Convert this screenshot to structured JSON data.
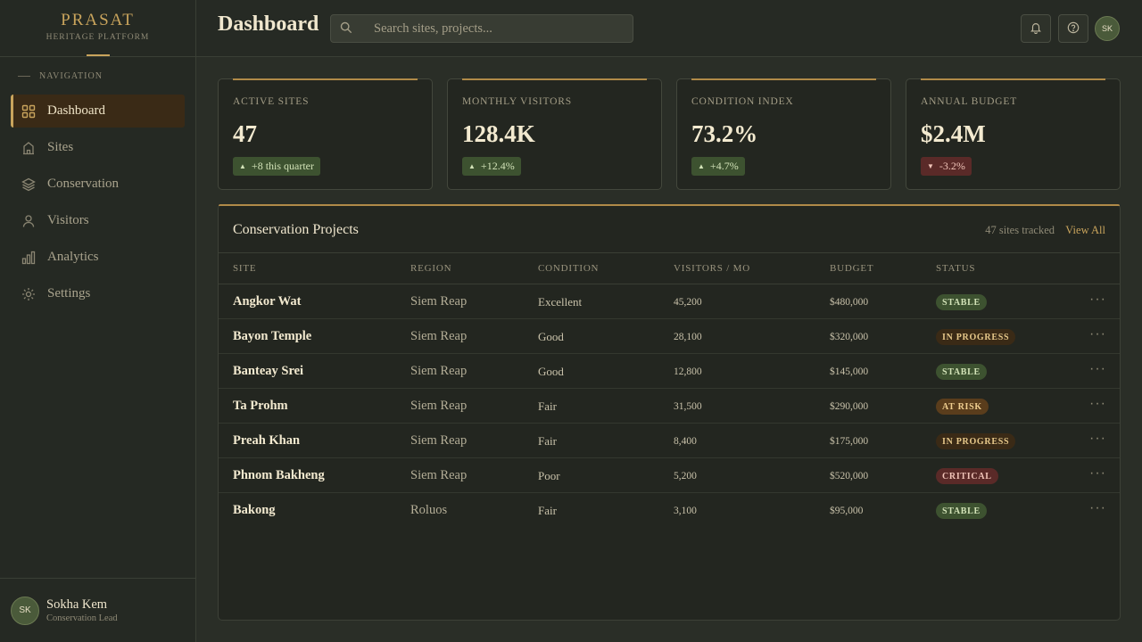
{
  "brand": {
    "name": "PRASAT",
    "subtitle": "HERITAGE PLATFORM"
  },
  "nav": {
    "heading": "NAVIGATION",
    "items": [
      {
        "label": "Dashboard",
        "icon": "grid-icon",
        "active": true
      },
      {
        "label": "Sites",
        "icon": "building-icon"
      },
      {
        "label": "Conservation",
        "icon": "layers-icon"
      },
      {
        "label": "Visitors",
        "icon": "person-icon"
      },
      {
        "label": "Analytics",
        "icon": "bar-chart-icon"
      },
      {
        "label": "Settings",
        "icon": "gear-icon"
      }
    ]
  },
  "user": {
    "initials": "SK",
    "name": "Sokha Kem",
    "role": "Conservation Lead"
  },
  "header": {
    "title": "Dashboard",
    "search_placeholder": "Search sites, projects...",
    "avatar_initials": "SK"
  },
  "stats": [
    {
      "label": "ACTIVE SITES",
      "value": "47",
      "delta": "+8 this quarter",
      "direction": "up"
    },
    {
      "label": "MONTHLY VISITORS",
      "value": "128.4K",
      "delta": "+12.4%",
      "direction": "up"
    },
    {
      "label": "CONDITION INDEX",
      "value": "73.2%",
      "delta": "+4.7%",
      "direction": "up"
    },
    {
      "label": "ANNUAL BUDGET",
      "value": "$2.4M",
      "delta": "-3.2%",
      "direction": "down"
    }
  ],
  "projects": {
    "title": "Conservation Projects",
    "count_text": "47 sites tracked",
    "view_all": "View All",
    "columns": [
      "SITE",
      "REGION",
      "CONDITION",
      "VISITORS / MO",
      "BUDGET",
      "STATUS"
    ],
    "more_glyph": "···",
    "rows": [
      {
        "site": "Angkor Wat",
        "region": "Siem Reap",
        "condition": "Excellent",
        "visitors": "45,200",
        "budget": "$480,000",
        "status": "STABLE",
        "status_type": "stable"
      },
      {
        "site": "Bayon Temple",
        "region": "Siem Reap",
        "condition": "Good",
        "visitors": "28,100",
        "budget": "$320,000",
        "status": "IN PROGRESS",
        "status_type": "progress"
      },
      {
        "site": "Banteay Srei",
        "region": "Siem Reap",
        "condition": "Good",
        "visitors": "12,800",
        "budget": "$145,000",
        "status": "STABLE",
        "status_type": "stable"
      },
      {
        "site": "Ta Prohm",
        "region": "Siem Reap",
        "condition": "Fair",
        "visitors": "31,500",
        "budget": "$290,000",
        "status": "AT RISK",
        "status_type": "risk"
      },
      {
        "site": "Preah Khan",
        "region": "Siem Reap",
        "condition": "Fair",
        "visitors": "8,400",
        "budget": "$175,000",
        "status": "IN PROGRESS",
        "status_type": "progress"
      },
      {
        "site": "Phnom Bakheng",
        "region": "Siem Reap",
        "condition": "Poor",
        "visitors": "5,200",
        "budget": "$520,000",
        "status": "CRITICAL",
        "status_type": "critical"
      },
      {
        "site": "Bakong",
        "region": "Roluos",
        "condition": "Fair",
        "visitors": "3,100",
        "budget": "$95,000",
        "status": "STABLE",
        "status_type": "stable"
      }
    ]
  },
  "colors": {
    "accent": "#c9a45c",
    "background": "#2a2e27",
    "panel": "#232620",
    "positive": "#3d5230",
    "negative": "#5a2a28"
  }
}
